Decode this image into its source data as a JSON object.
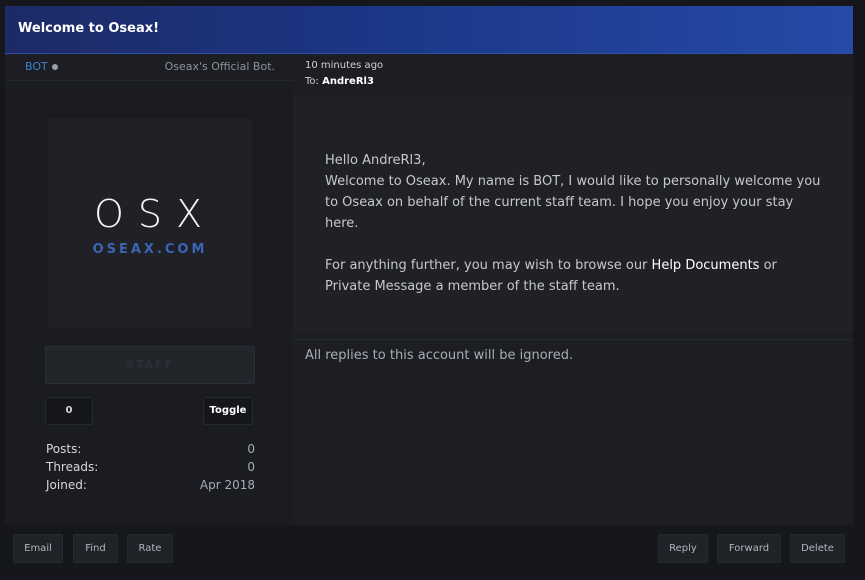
{
  "window": {
    "title": "Welcome to Oseax!"
  },
  "author": {
    "username": "BOT",
    "user_title": "Oseax's Official Bot.",
    "avatar": {
      "logo_text": "OSX",
      "logo_subtext": "OSEAX.COM"
    },
    "group_badge": "STAFF",
    "reputation": "0",
    "toggle_label": "Toggle",
    "stats": [
      {
        "label": "Posts:",
        "value": "0"
      },
      {
        "label": "Threads:",
        "value": "0"
      },
      {
        "label": "Joined:",
        "value": "Apr 2018"
      }
    ]
  },
  "message": {
    "time": "10 minutes ago",
    "to_label": "To:",
    "to_user": "AndreRl3",
    "greeting": "Hello AndreRl3,",
    "body1": "Welcome to Oseax. My name is BOT, I would like to personally welcome you to Oseax on behalf of the current staff team. I hope you enjoy your stay here.",
    "body2_pre": "For anything further, you may wish to browse our ",
    "help_link": "Help Documents",
    "body2_post": " or Private Message a member of the staff team.",
    "signature": "All replies to this account will be ignored."
  },
  "footer": {
    "left_buttons": [
      "Email",
      "Find",
      "Rate"
    ],
    "right_buttons": [
      "Reply",
      "Forward",
      "Delete"
    ]
  },
  "colors": {
    "title_gradient_start": "#1d2a66",
    "title_gradient_end": "#254aa8",
    "username": "#3f7fd0"
  },
  "icons": {
    "status_indicator": "online-status-dot-icon"
  }
}
